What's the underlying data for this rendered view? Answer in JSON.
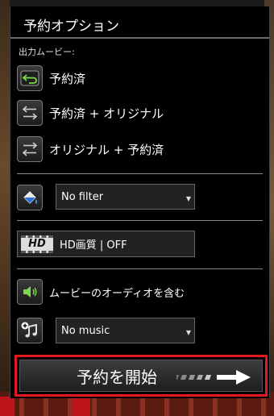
{
  "dialog": {
    "title": "予約オプション",
    "output_label": "出力ムービー:"
  },
  "options": {
    "reversed": "予約済",
    "reversed_original": "予約済 + オリジナル",
    "original_reversed": "オリジナル + 予約済"
  },
  "filter": {
    "selected": "No filter"
  },
  "hd": {
    "badge": "HD",
    "label": "HD画質 | OFF"
  },
  "audio": {
    "label": "ムービーのオーディオを含む"
  },
  "music": {
    "selected": "No music"
  },
  "start": {
    "label": "予約を開始"
  },
  "colors": {
    "accent_green": "#7fd84a",
    "highlight_red": "#e11a22"
  },
  "icons": [
    "undo-arrow-icon",
    "swap-arrows-icon",
    "swap-arrows-icon",
    "paint-bucket-icon",
    "hd-icon",
    "speaker-icon",
    "music-plus-icon",
    "arrow-right-icon"
  ]
}
